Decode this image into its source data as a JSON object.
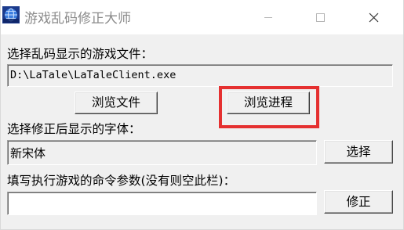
{
  "window": {
    "title": "游戏乱码修正大师",
    "icon": "globe-app-icon"
  },
  "file_section": {
    "label": "选择乱码显示的游戏文件：",
    "path_value": "D:\\LaTale\\LaTaleClient.exe",
    "browse_file_label": "浏览文件",
    "browse_process_label": "浏览进程"
  },
  "font_section": {
    "label": "选择修正后显示的字体：",
    "font_value": "新宋体",
    "select_label": "选择"
  },
  "args_section": {
    "label": "填写执行游戏的命令参数(没有则空此栏)：",
    "args_value": "",
    "fix_label": "修正"
  },
  "colors": {
    "highlight": "#e53030",
    "dialog_bg": "#f0f0f0"
  }
}
